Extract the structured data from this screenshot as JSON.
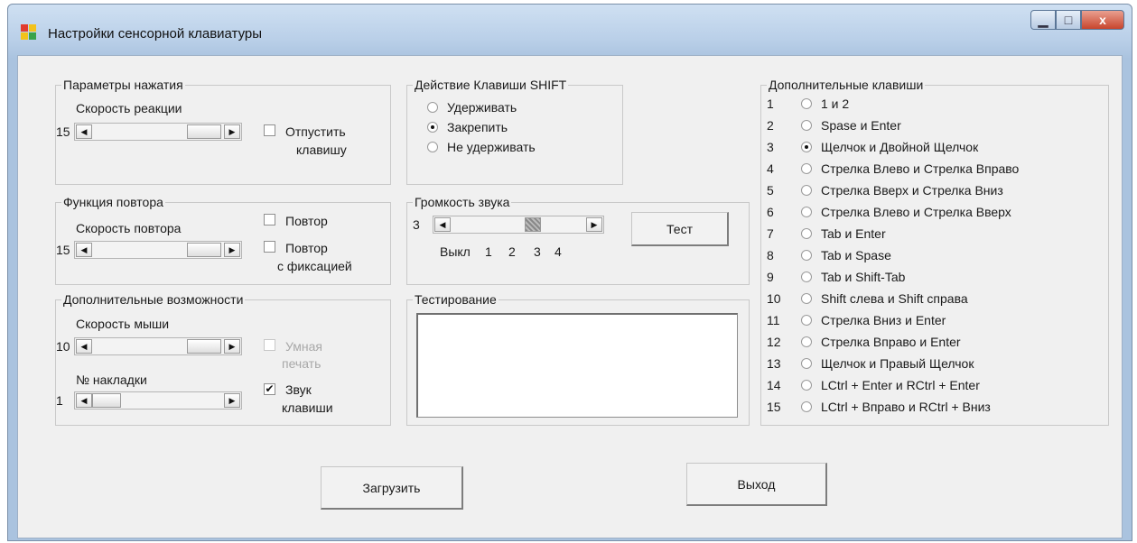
{
  "window": {
    "title": "Настройки сенсорной клавиатуры",
    "minimize": "▁",
    "maximize": "□",
    "close": "x"
  },
  "press": {
    "label": "Параметры нажатия",
    "speed_label": "Скорость реакции",
    "speed_value": "15",
    "release_line1": "Отпустить",
    "release_line2": "клавишу",
    "release_checked": false
  },
  "repeat": {
    "label": "Функция повтора",
    "speed_label": "Скорость повтора",
    "speed_value": "15",
    "repeat": "Повтор",
    "repeat_fix_line1": "Повтор",
    "repeat_fix_line2": "с фиксацией",
    "repeat_checked": false,
    "repeat_fix_checked": false
  },
  "extra": {
    "label": "Дополнительные возможности",
    "mouse_label": "Скорость мыши",
    "mouse_value": "10",
    "smart_line1": "Умная",
    "smart_line2": "печать",
    "smart_checked": false,
    "smart_disabled": true,
    "overlay_label": "№ накладки",
    "overlay_value": "1",
    "sound_line1": "Звук",
    "sound_line2": "клавиши",
    "sound_checked": true
  },
  "shift": {
    "label": "Действие Клавиши SHIFT",
    "options": [
      "Удерживать",
      "Закрепить",
      "Не удерживать"
    ],
    "selected": 1
  },
  "volume": {
    "label": "Громкость звука",
    "value": "3",
    "ticks": [
      "Выкл",
      "1",
      "2",
      "3",
      "4"
    ],
    "level": 3,
    "max": 4,
    "test": "Тест"
  },
  "testing": {
    "label": "Тестирование",
    "text": ""
  },
  "keys": {
    "label": "Дополнительные клавиши",
    "selected": 2,
    "items": [
      {
        "num": "1",
        "label": "1 и 2"
      },
      {
        "num": "2",
        "label": "Spase и Enter"
      },
      {
        "num": "3",
        "label": "Щелчок и Двойной Щелчок"
      },
      {
        "num": "4",
        "label": "Стрелка Влево и Стрелка Вправо"
      },
      {
        "num": "5",
        "label": "Стрелка Вверх и Стрелка Вниз"
      },
      {
        "num": "6",
        "label": "Стрелка Влево и Стрелка Вверх"
      },
      {
        "num": "7",
        "label": "Tab и Enter"
      },
      {
        "num": "8",
        "label": "Tab и Spase"
      },
      {
        "num": "9",
        "label": "Tab и Shift-Tab"
      },
      {
        "num": "10",
        "label": "Shift слева и Shift справа"
      },
      {
        "num": "11",
        "label": "Стрелка Вниз и Enter"
      },
      {
        "num": "12",
        "label": "Стрелка Вправо и Enter"
      },
      {
        "num": "13",
        "label": "Щелчок и Правый Щелчок"
      },
      {
        "num": "14",
        "label": "LCtrl + Enter и RCtrl + Enter"
      },
      {
        "num": "15",
        "label": "LCtrl + Вправо и RCtrl + Вниз"
      }
    ]
  },
  "buttons": {
    "load": "Загрузить",
    "exit": "Выход"
  },
  "icons": {
    "left_arrow": "◀",
    "right_arrow": "▶",
    "check": "✔"
  }
}
